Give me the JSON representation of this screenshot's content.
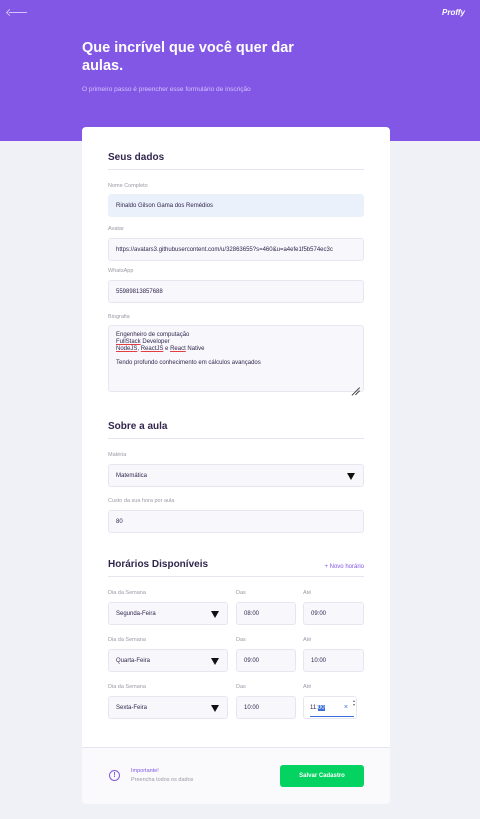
{
  "header": {
    "brand": "Proffy",
    "title": "Que incrível que você quer dar aulas.",
    "subtitle": "O primeiro passo é preencher esse formulário de inscrição"
  },
  "personal": {
    "legend": "Seus dados",
    "name_label": "Nome Completo",
    "name_value": "Rinaldo Gilson Gama dos Remédios",
    "avatar_label": "Avatar",
    "avatar_value": "https://avatars3.githubusercontent.com/u/32863655?s=460&u=a4efe1f5b574ec3c",
    "whatsapp_label": "WhatsApp",
    "whatsapp_value": "55989813857688",
    "bio_label": "Biografia",
    "bio_line1": "Engenheiro de computação",
    "bio_line2_a": "FullStack",
    "bio_line2_b": " Developer",
    "bio_line3_a": "NodeJS",
    "bio_line3_b": ", ",
    "bio_line3_c": "ReactJS",
    "bio_line3_d": " e ",
    "bio_line3_e": "React",
    "bio_line3_f": " Native",
    "bio_line4": "",
    "bio_line5": "Tendo profundo conhecimento em cálculos avançados"
  },
  "class": {
    "legend": "Sobre a aula",
    "subject_label": "Matéria",
    "subject_value": "Matemática",
    "cost_label": "Custo da sua hora por aula",
    "cost_value": "80"
  },
  "schedule": {
    "legend": "Horários Disponíveis",
    "new_label": "+ Novo horário",
    "day_label": "Dia da Semana",
    "from_label": "Das",
    "to_label": "Até",
    "items": [
      {
        "day": "Segunda-Feira",
        "from": "08:00",
        "to": "09:00"
      },
      {
        "day": "Quarta-Feira",
        "from": "09:00",
        "to": "10:00"
      },
      {
        "day": "Sexta-Feira",
        "from": "10:00",
        "to_hours": "11:",
        "to_minutes": "00"
      }
    ],
    "clear_glyph": "×"
  },
  "footer": {
    "warn_icon": "!",
    "warn_title": "Importante!",
    "warn_text": "Preencha todos os dados",
    "save_label": "Salvar Cadastro"
  },
  "colors": {
    "primary": "#8257e5",
    "success": "#04d361",
    "background": "#f0f0f7"
  }
}
